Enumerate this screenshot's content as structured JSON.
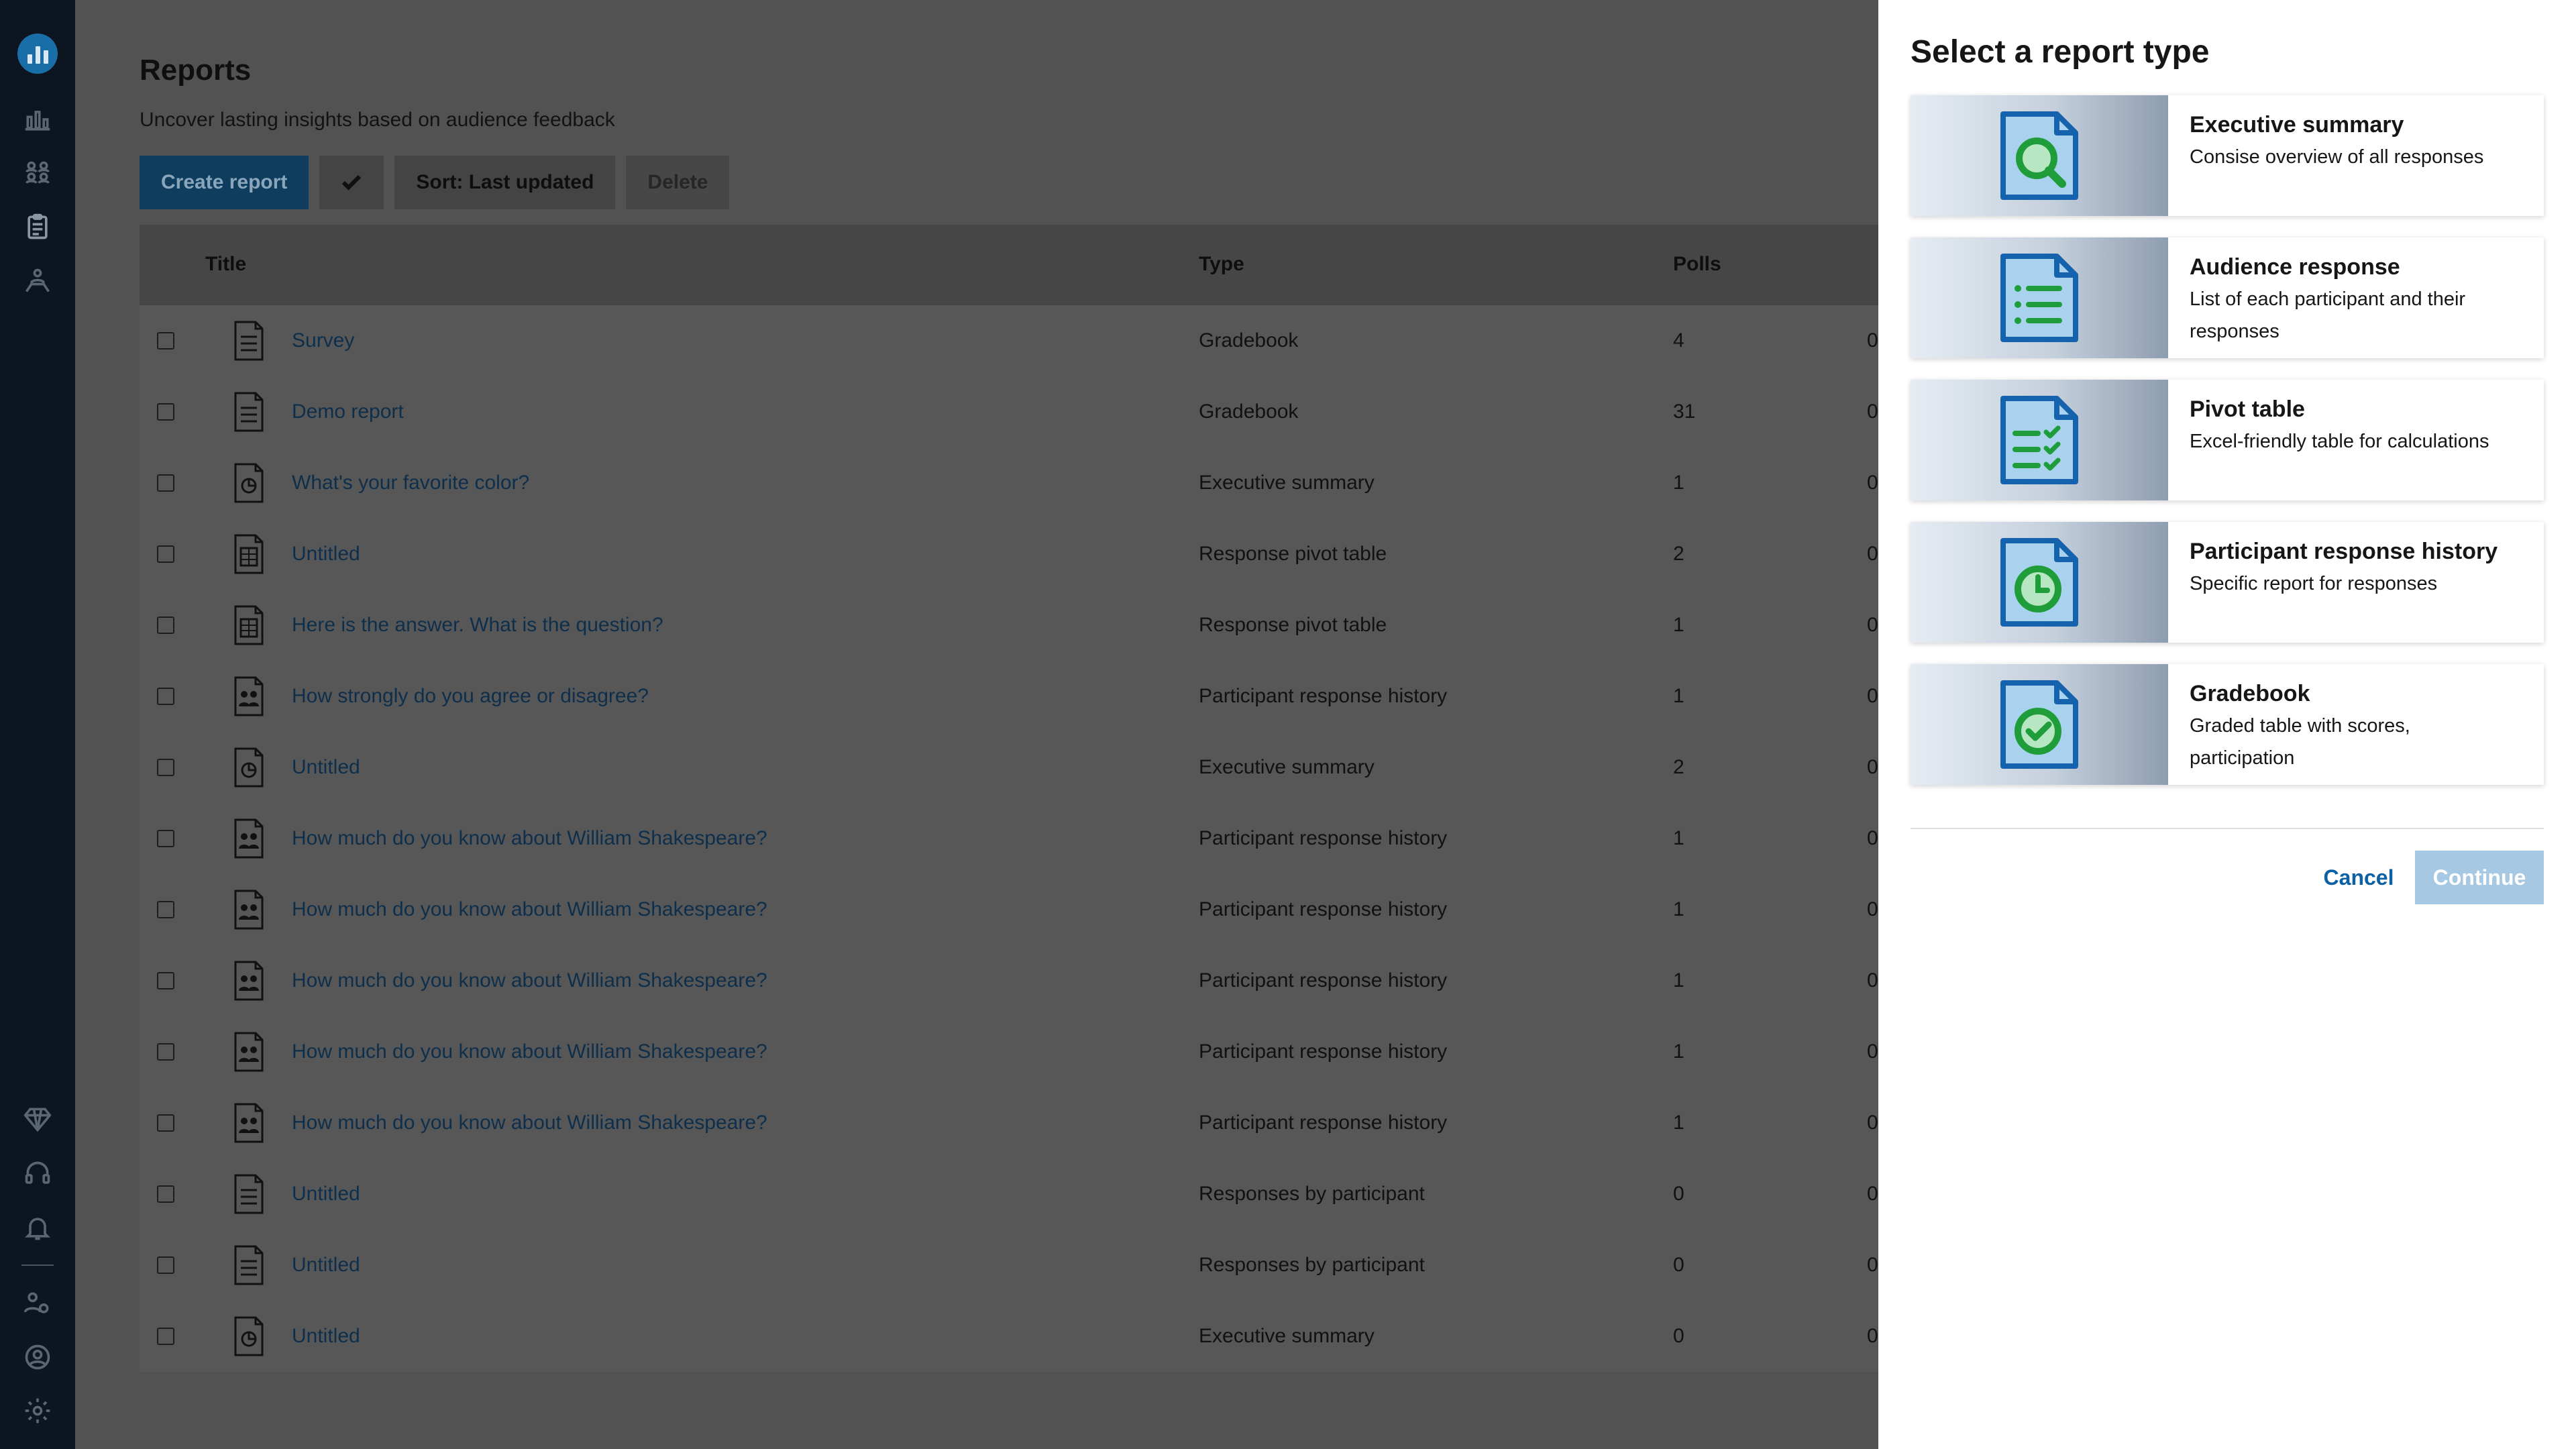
{
  "page": {
    "title": "Reports",
    "subtitle": "Uncover lasting insights based on audience feedback"
  },
  "toolbar": {
    "create_label": "Create report",
    "select_icon": "check-icon",
    "sort_label": "Sort: Last updated",
    "delete_label": "Delete"
  },
  "table": {
    "columns": [
      "Title",
      "Type",
      "Polls"
    ],
    "rows": [
      {
        "title": "Survey",
        "type": "Gradebook",
        "polls": "4",
        "extra": "0",
        "icon": "list"
      },
      {
        "title": "Demo report",
        "type": "Gradebook",
        "polls": "31",
        "extra": "0",
        "icon": "list"
      },
      {
        "title": "What's your favorite color?",
        "type": "Executive summary",
        "polls": "1",
        "extra": "0",
        "icon": "summary"
      },
      {
        "title": "Untitled",
        "type": "Response pivot table",
        "polls": "2",
        "extra": "0",
        "icon": "pivot"
      },
      {
        "title": "Here is the answer. What is the question?",
        "type": "Response pivot table",
        "polls": "1",
        "extra": "0",
        "icon": "pivot"
      },
      {
        "title": "How strongly do you agree or disagree?",
        "type": "Participant response history",
        "polls": "1",
        "extra": "0",
        "icon": "people"
      },
      {
        "title": "Untitled",
        "type": "Executive summary",
        "polls": "2",
        "extra": "0",
        "icon": "summary"
      },
      {
        "title": "How much do you know about William Shakespeare?",
        "type": "Participant response history",
        "polls": "1",
        "extra": "0",
        "icon": "people"
      },
      {
        "title": "How much do you know about William Shakespeare?",
        "type": "Participant response history",
        "polls": "1",
        "extra": "0",
        "icon": "people"
      },
      {
        "title": "How much do you know about William Shakespeare?",
        "type": "Participant response history",
        "polls": "1",
        "extra": "0",
        "icon": "people"
      },
      {
        "title": "How much do you know about William Shakespeare?",
        "type": "Participant response history",
        "polls": "1",
        "extra": "0",
        "icon": "people"
      },
      {
        "title": "How much do you know about William Shakespeare?",
        "type": "Participant response history",
        "polls": "1",
        "extra": "0",
        "icon": "people"
      },
      {
        "title": "Untitled",
        "type": "Responses by participant",
        "polls": "0",
        "extra": "0",
        "icon": "list"
      },
      {
        "title": "Untitled",
        "type": "Responses by participant",
        "polls": "0",
        "extra": "0",
        "icon": "list"
      },
      {
        "title": "Untitled",
        "type": "Executive summary",
        "polls": "0",
        "extra": "0",
        "icon": "summary"
      }
    ]
  },
  "panel": {
    "title": "Select a report type",
    "cards": [
      {
        "title": "Executive summary",
        "desc": [
          "Consise overview of all responses"
        ],
        "icon": "magnifier-icon"
      },
      {
        "title": "Audience response",
        "desc": [
          "List of each participant and their",
          "responses"
        ],
        "icon": "list-icon"
      },
      {
        "title": "Pivot table",
        "desc": [
          "Excel-friendly table for calculations"
        ],
        "icon": "checklist-icon"
      },
      {
        "title": "Participant response history",
        "desc": [
          "Specific report for responses"
        ],
        "icon": "clock-icon"
      },
      {
        "title": "Gradebook",
        "desc": [
          "Graded table with scores,",
          "participation"
        ],
        "icon": "check-circle-icon"
      }
    ],
    "cancel_label": "Cancel",
    "continue_label": "Continue"
  },
  "colors": {
    "accent": "#0b61a4",
    "primary_button_disabled": "#a6c8e3",
    "overlay": "#525252",
    "rail": "#0c1520",
    "icon_green": "#1f9d3a",
    "icon_blue": "#1562ad"
  }
}
